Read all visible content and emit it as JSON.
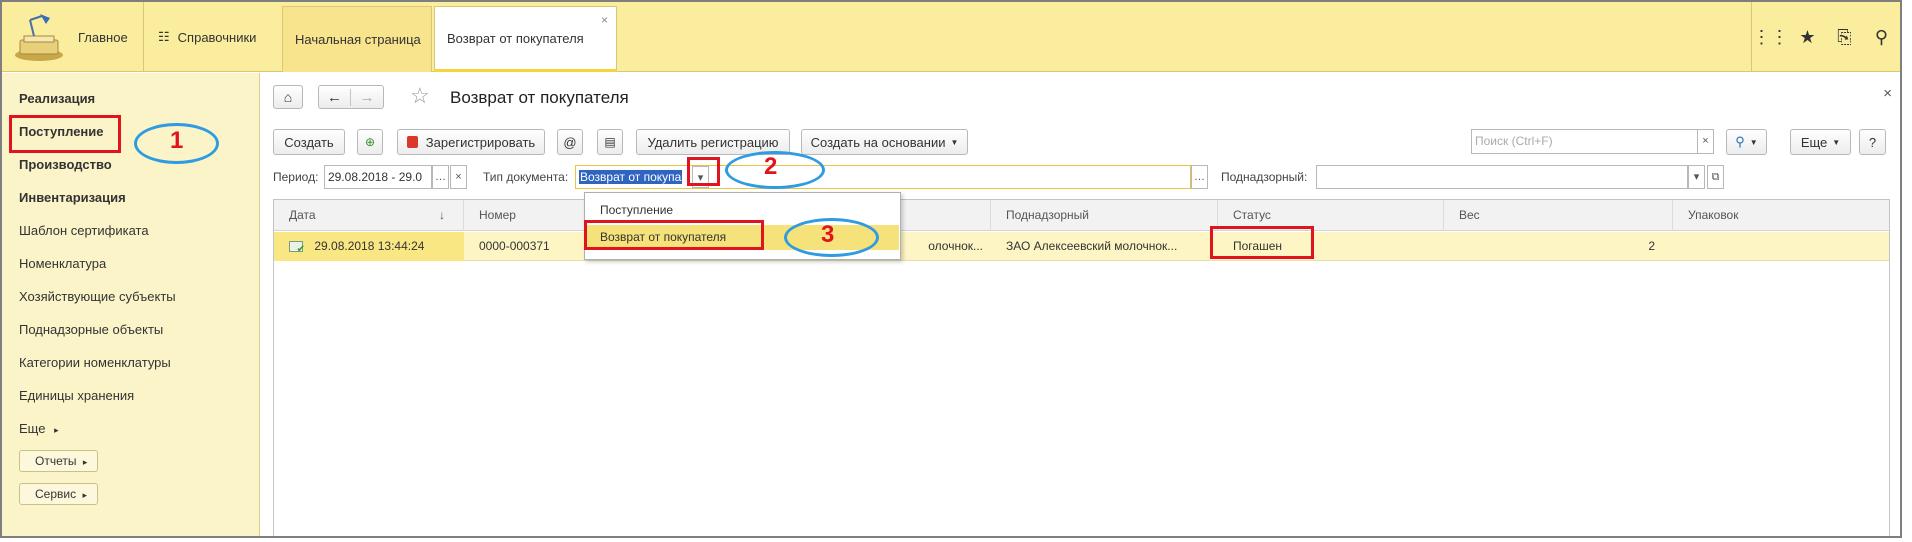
{
  "topbar": {
    "home_label": "Главное",
    "refs_label": "Справочники",
    "tabs": [
      {
        "label": "Начальная страница",
        "active": false
      },
      {
        "label": "Возврат от покупателя",
        "active": true,
        "close": "×"
      }
    ],
    "right_icons": [
      "grid-icon",
      "star-icon",
      "history-icon",
      "search-icon"
    ]
  },
  "sidebar": {
    "sections": [
      {
        "label": "Реализация",
        "bold": true
      },
      {
        "label": "Поступление",
        "bold": true,
        "highlighted": true
      },
      {
        "label": "Производство",
        "bold": true
      },
      {
        "label": "Инвентаризация",
        "bold": true
      },
      {
        "label": "Шаблон сертификата",
        "bold": false
      },
      {
        "label": "Номенклатура",
        "bold": false
      },
      {
        "label": "Хозяйствующие субъекты",
        "bold": false
      },
      {
        "label": "Поднадзорные объекты",
        "bold": false
      },
      {
        "label": "Категории номенклатуры",
        "bold": false
      },
      {
        "label": "Единицы хранения",
        "bold": false
      }
    ],
    "more_label": "Еще",
    "more_arrow": "▸",
    "reports_label": "Отчеты",
    "service_label": "Сервис"
  },
  "page": {
    "title": "Возврат от покупателя",
    "close": "×"
  },
  "toolbar": {
    "create_label": "Создать",
    "register_label": "Зарегистрировать",
    "at_label": "@",
    "delete_reg_label": "Удалить регистрацию",
    "create_based_label": "Создать на основании",
    "more_label": "Еще",
    "help_label": "?",
    "search_placeholder": "Поиск (Ctrl+F)"
  },
  "filters": {
    "period_label": "Период:",
    "period_value": "29.08.2018 - 29.0",
    "doc_type_label": "Тип документа:",
    "doc_type_value": "Возврат от покупа",
    "supervised_label": "Поднадзорный:",
    "supervised_value": ""
  },
  "dropdown": {
    "options": [
      {
        "label": "Поступление",
        "selected": false
      },
      {
        "label": "Возврат от покупателя",
        "selected": true
      }
    ]
  },
  "table": {
    "columns": [
      "Дата",
      "Номер",
      "",
      "Поднадзорный",
      "Статус",
      "Вес",
      "Упаковок"
    ],
    "sort_indicator": "↓",
    "rows": [
      {
        "date": "29.08.2018 13:44:24",
        "number": "0000-000371",
        "counterparty": "олочнок...",
        "supervised": "ЗАО Алексеевский молочнок...",
        "status": "Погашен",
        "weight": "2",
        "packages": ""
      }
    ]
  },
  "annotations": {
    "n1": "1",
    "n2": "2",
    "n3": "3",
    "marker_color": "#e0141e",
    "ellipse_color": "#2f9be0"
  }
}
